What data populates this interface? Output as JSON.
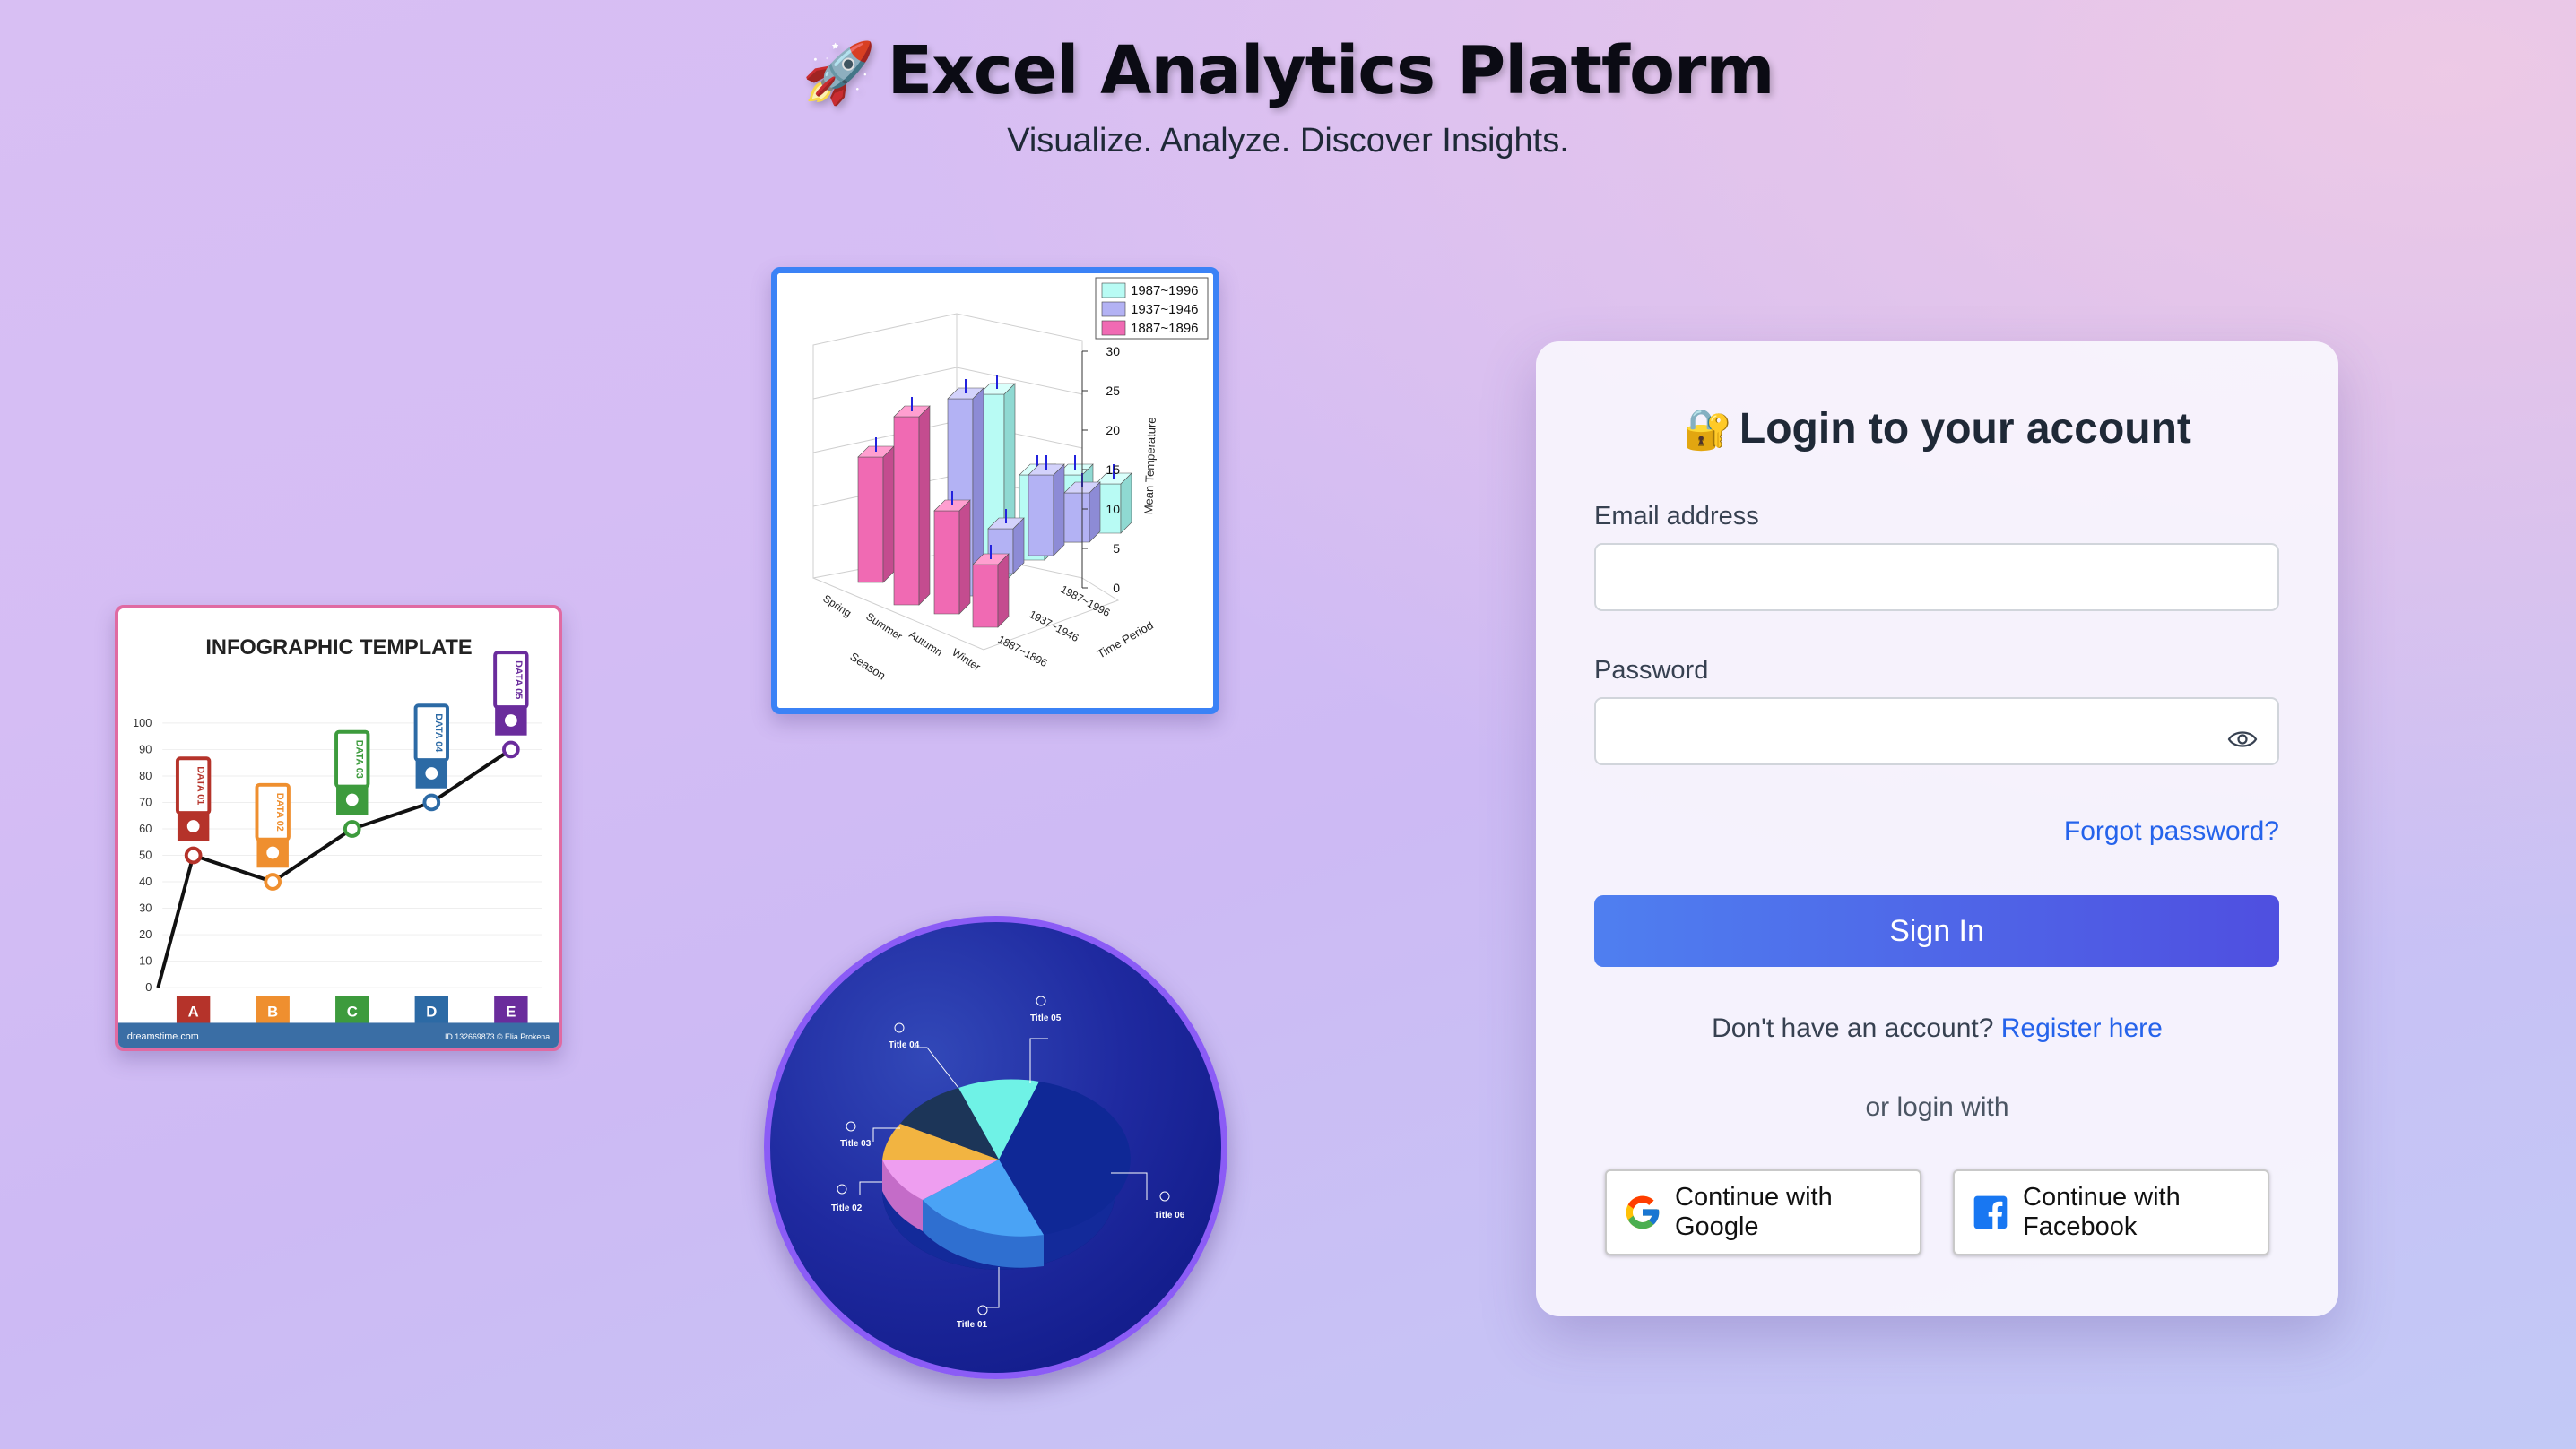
{
  "header": {
    "rocket_emoji": "🚀",
    "title": "Excel Analytics Platform",
    "subtitle": "Visualize. Analyze. Discover Insights."
  },
  "infographic": {
    "title": "INFOGRAPHIC TEMPLATE",
    "y_ticks": [
      "100",
      "90",
      "80",
      "70",
      "60",
      "50",
      "40",
      "30",
      "20",
      "10",
      "0"
    ],
    "categories": [
      "A",
      "B",
      "C",
      "D",
      "E"
    ],
    "tags": [
      "DATA 01",
      "DATA 02",
      "DATA 03",
      "DATA 04",
      "DATA 05"
    ],
    "tag_colors": [
      "#b5332a",
      "#ef8f2f",
      "#3d9b3d",
      "#2c6aa5",
      "#6a2c9c"
    ],
    "footer_left": "dreamstime.com",
    "footer_right": "ID 132669873 © Elia Prokena"
  },
  "bar3d": {
    "legend": [
      "1987~1996",
      "1937~1946",
      "1887~1896"
    ],
    "legend_colors": [
      "#b8fbf4",
      "#b3b2f4",
      "#f06ab3"
    ],
    "z_ticks": [
      "30",
      "25",
      "20",
      "15",
      "10",
      "5",
      "0"
    ],
    "z_label": "Mean Temperature",
    "seasons": [
      "Spring",
      "Summer",
      "Autumn",
      "Winter"
    ],
    "x_label": "Season",
    "periods": [
      "1987~1996",
      "1937~1946",
      "1887~1896"
    ],
    "y_label": "Time Period"
  },
  "pie": {
    "labels": [
      "Title 01",
      "Title 02",
      "Title 03",
      "Title 04",
      "Title 05",
      "Title 06"
    ]
  },
  "login": {
    "lock_emoji": "🔐",
    "title": "Login to your account",
    "email_label": "Email address",
    "email_value": "",
    "password_label": "Password",
    "password_value": "",
    "forgot": "Forgot password?",
    "signin": "Sign In",
    "no_account": "Don't have an account?",
    "register": "Register here",
    "or_login": "or login with",
    "google": "Continue with Google",
    "facebook": "Continue with Facebook"
  }
}
